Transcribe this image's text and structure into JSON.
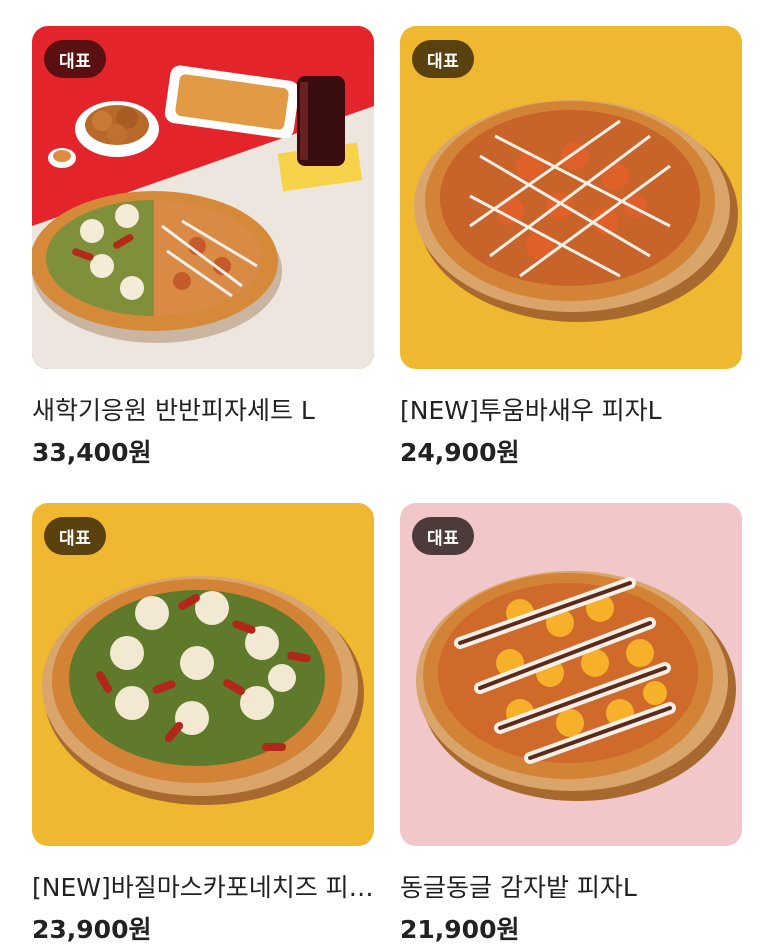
{
  "colors": {
    "badge_dark_red": "#5a1010",
    "badge_dark_olive": "#5a4210",
    "badge_dark_brown": "#4d3a3a",
    "bg_red": "#e3242b",
    "bg_yellow": "#f0b830",
    "bg_pink": "#f2c7c9",
    "crust": "#d98a3a",
    "board": "#c98d55"
  },
  "products": [
    {
      "badge": "대표",
      "name": "새학기응원 반반피자세트 L",
      "price": "33,400원",
      "image": "pizza-set-image"
    },
    {
      "badge": "대표",
      "name": "[NEW]투움바새우 피자L",
      "price": "24,900원",
      "image": "shrimp-pizza-image"
    },
    {
      "badge": "대표",
      "name": "[NEW]바질마스카포네치즈 피자L",
      "price": "23,900원",
      "image": "basil-pizza-image"
    },
    {
      "badge": "대표",
      "name": "동글동글 감자밭 피자L",
      "price": "21,900원",
      "image": "potato-pizza-image"
    }
  ]
}
